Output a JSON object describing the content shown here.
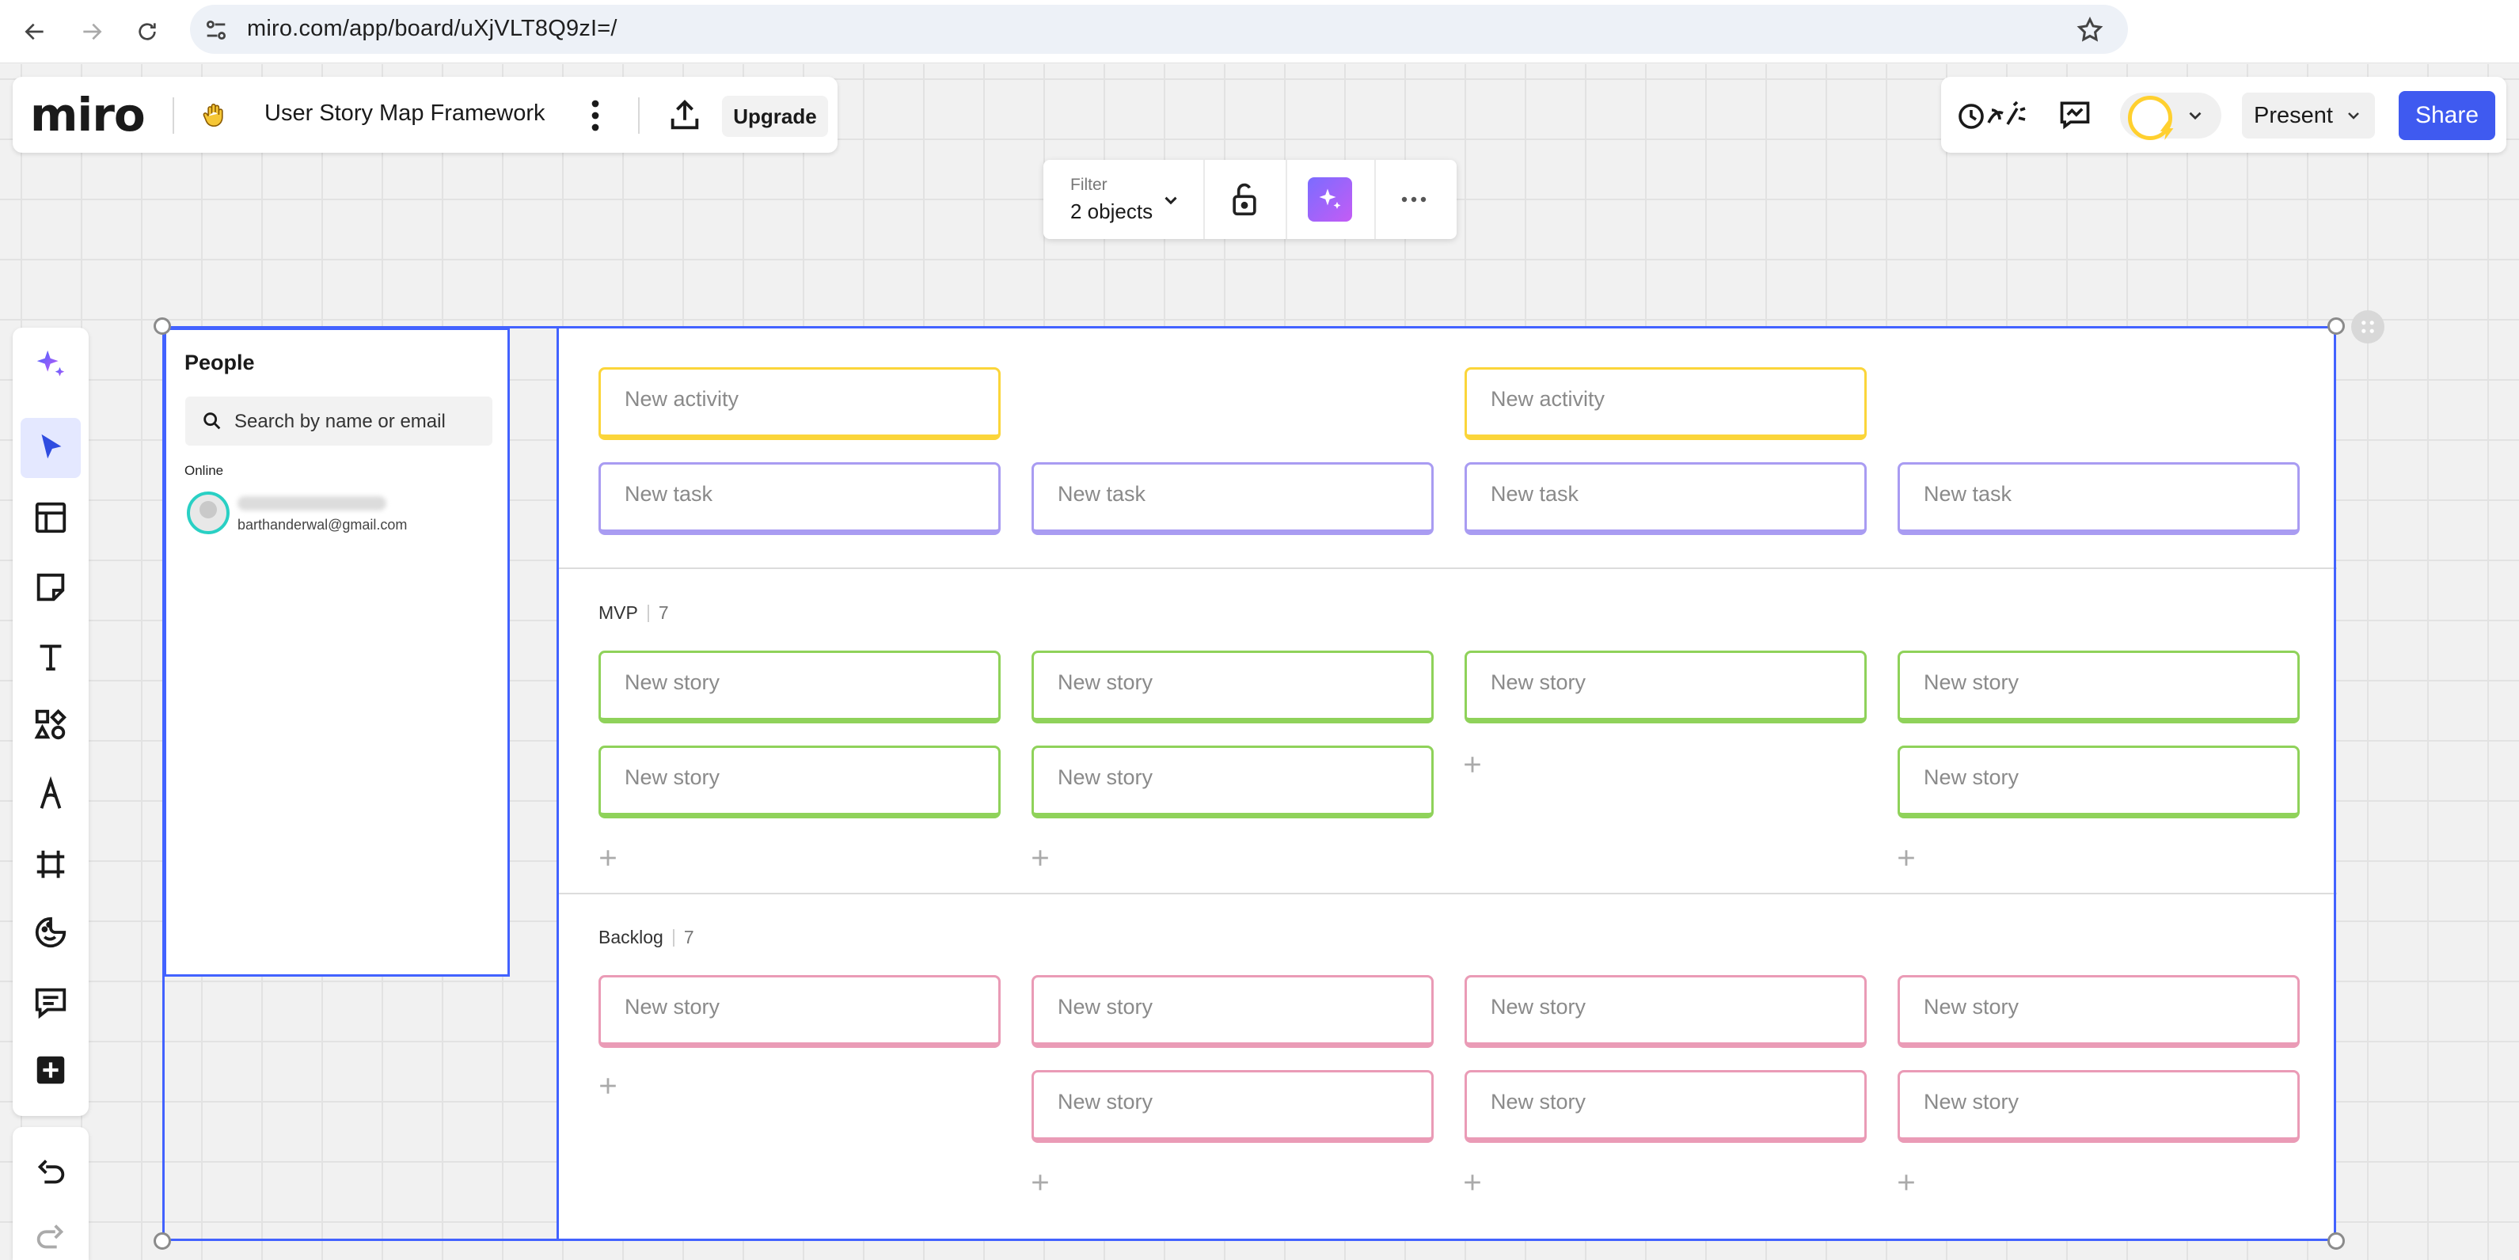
{
  "browser": {
    "url": "miro.com/app/board/uXjVLT8Q9zI=/"
  },
  "header": {
    "logo": "miro",
    "board_title": "User Story Map Framework",
    "upgrade_label": "Upgrade",
    "present_label": "Present",
    "share_label": "Share"
  },
  "context_toolbar": {
    "filter_label": "Filter",
    "filter_value": "2 objects"
  },
  "people_panel": {
    "title": "People",
    "search_placeholder": "Search by name or email",
    "online_label": "Online",
    "user_email": "barthanderwal@gmail.com"
  },
  "story_map": {
    "activities": [
      "New activity",
      "New activity"
    ],
    "tasks": [
      "New task",
      "New task",
      "New task",
      "New task"
    ],
    "mvp": {
      "label": "MVP",
      "count": "7",
      "stories": [
        "New story",
        "New story",
        "New story",
        "New story",
        "New story",
        "New story",
        "New story"
      ]
    },
    "backlog": {
      "label": "Backlog",
      "count": "7",
      "stories": [
        "New story",
        "New story",
        "New story",
        "New story",
        "New story",
        "New story",
        "New story"
      ]
    }
  },
  "icons": {
    "toolbar": [
      "ai-sparkle-icon",
      "select-cursor-icon",
      "templates-icon",
      "sticky-note-icon",
      "text-icon",
      "shapes-icon",
      "pen-icon",
      "frame-icon",
      "stickers-icon",
      "comment-icon",
      "add-more-icon",
      "undo-icon",
      "redo-icon"
    ]
  },
  "colors": {
    "accent": "#4262ff",
    "share_button": "#3f5af0",
    "activity_card": "#fbd53a",
    "task_card": "#a99cf2",
    "mvp_card": "#8fd25a",
    "backlog_card": "#ea9bb6"
  }
}
